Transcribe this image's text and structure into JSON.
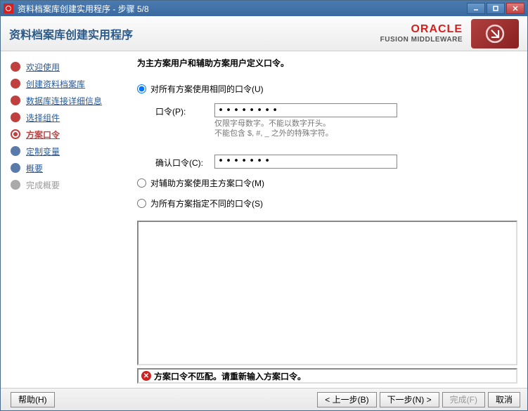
{
  "window": {
    "title": "资料档案库创建实用程序 - 步骤 5/8"
  },
  "header": {
    "title": "资料档案库创建实用程序",
    "brand_top": "ORACLE",
    "brand_bottom": "FUSION MIDDLEWARE"
  },
  "sidebar": {
    "steps": [
      {
        "label": "欢迎使用",
        "state": "done"
      },
      {
        "label": "创建资料档案库",
        "state": "done"
      },
      {
        "label": "数据库连接详细信息",
        "state": "done"
      },
      {
        "label": "选择组件",
        "state": "done"
      },
      {
        "label": "方案口令",
        "state": "current"
      },
      {
        "label": "定制变量",
        "state": "pending"
      },
      {
        "label": "概要",
        "state": "pending"
      },
      {
        "label": "完成概要",
        "state": "disabled"
      }
    ]
  },
  "content": {
    "instruction": "为主方案用户和辅助方案用户定义口令。",
    "radio_same": "对所有方案使用相同的口令(U)",
    "radio_aux": "对辅助方案使用主方案口令(M)",
    "radio_diff": "为所有方案指定不同的口令(S)",
    "label_password": "口令(P):",
    "label_confirm": "确认口令(C):",
    "hint_line1": "仅限字母数字。不能以数字开头。",
    "hint_line2": "不能包含 $, #, _ 之外的特殊字符。",
    "password_value": "••••••••",
    "confirm_value": "•••••••",
    "error_text": "方案口令不匹配。请重新输入方案口令。",
    "selected_radio": "same"
  },
  "footer": {
    "help": "帮助(H)",
    "back": "< 上一步(B)",
    "next": "下一步(N) >",
    "finish": "完成(F)",
    "cancel": "取消"
  }
}
